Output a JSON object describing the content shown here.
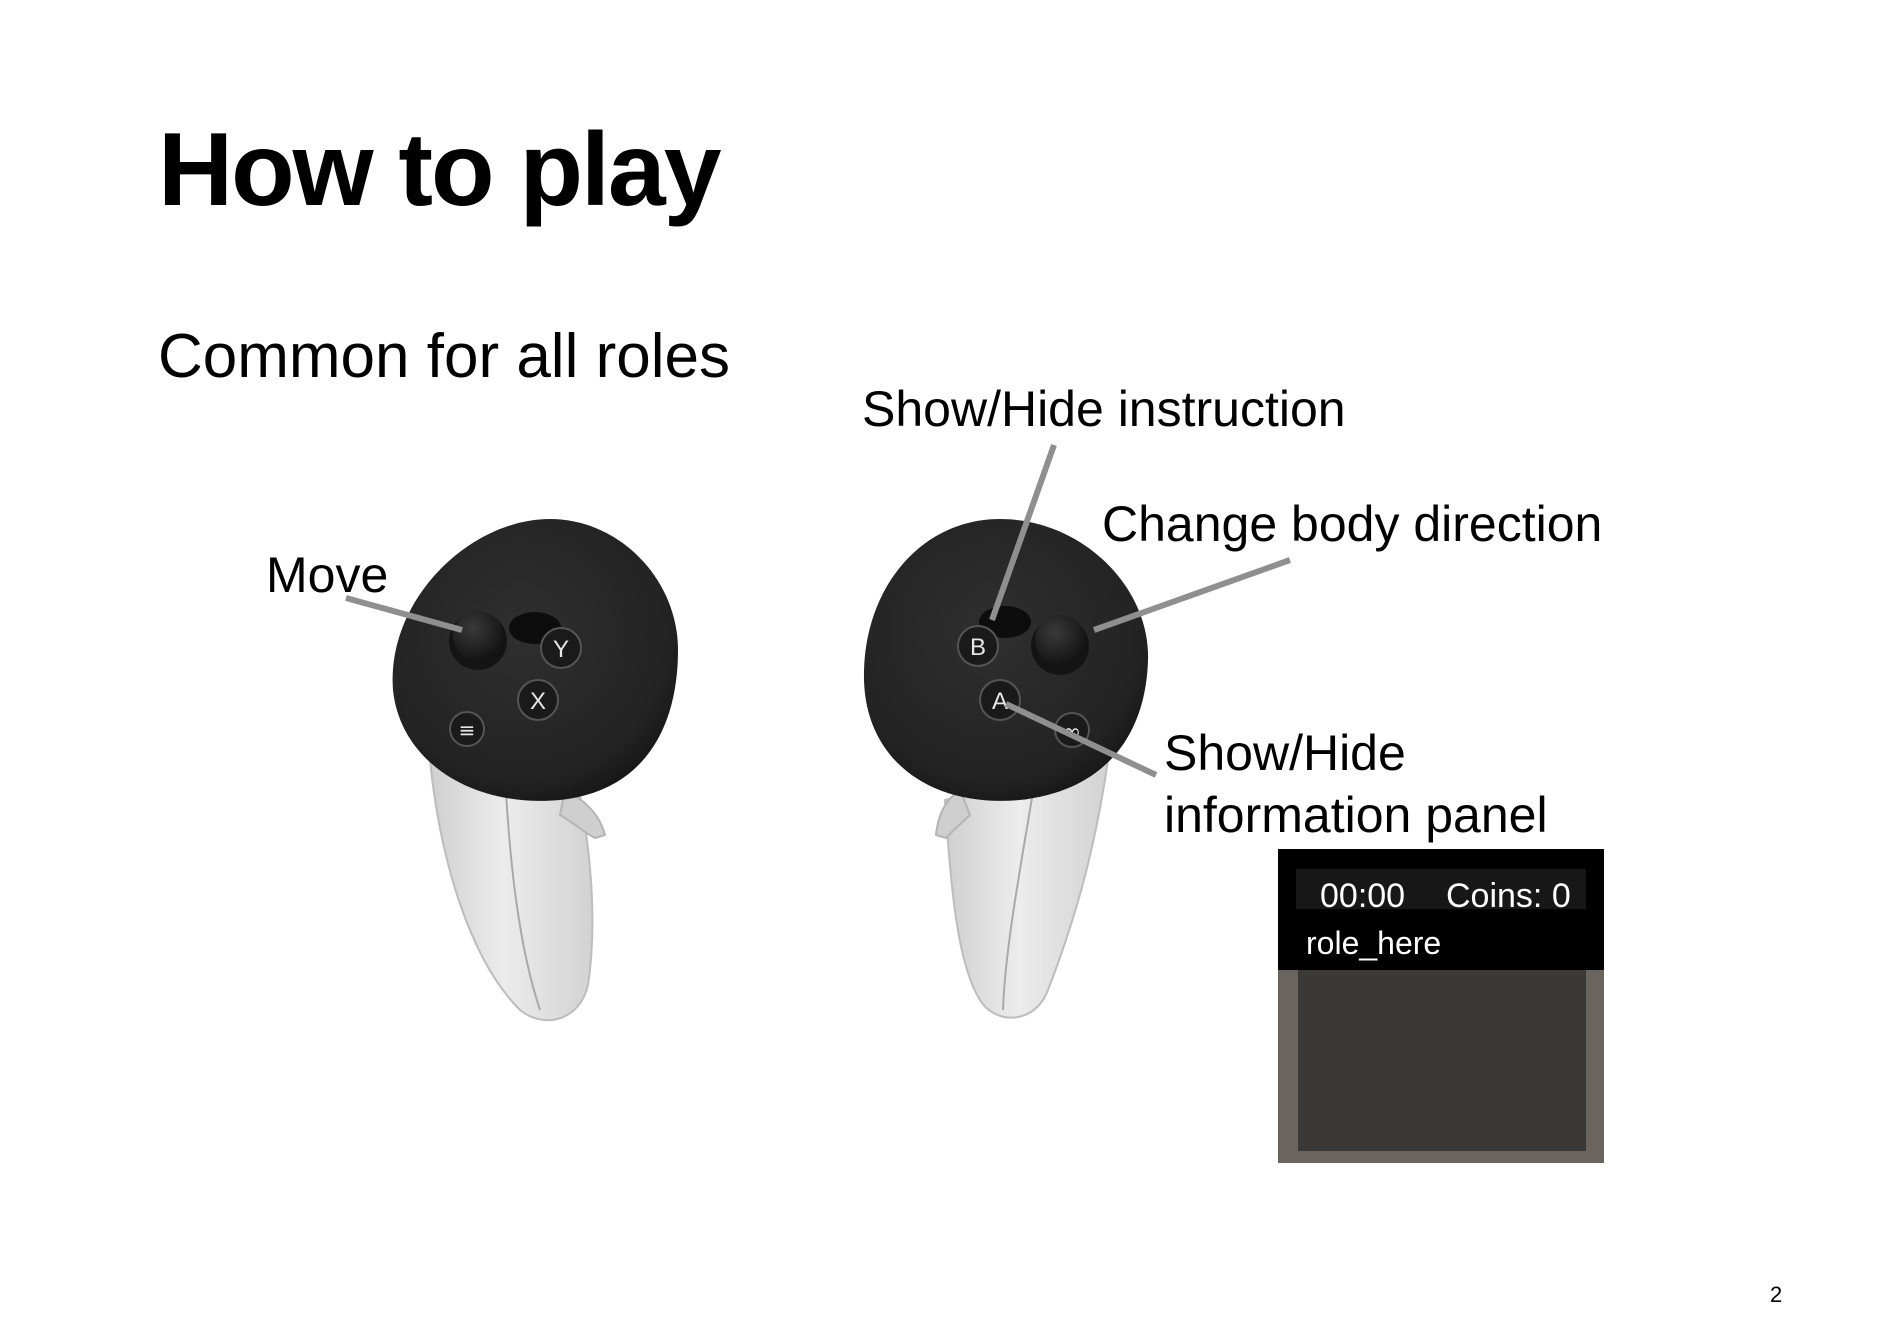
{
  "slide": {
    "title": "How to play",
    "subtitle": "Common for all roles",
    "page_number": "2"
  },
  "labels": {
    "show_hide_instruction": "Show/Hide instruction",
    "change_body_direction": "Change body direction",
    "move": "Move",
    "info_panel_line1": "Show/Hide",
    "info_panel_line2": "information panel"
  },
  "left_controller": {
    "buttons": [
      "Y",
      "X",
      "≡"
    ]
  },
  "right_controller": {
    "buttons": [
      "B",
      "A",
      "∞"
    ]
  },
  "info_panel": {
    "time": "00:00",
    "coins": "Coins: 0",
    "role": "role_here"
  }
}
